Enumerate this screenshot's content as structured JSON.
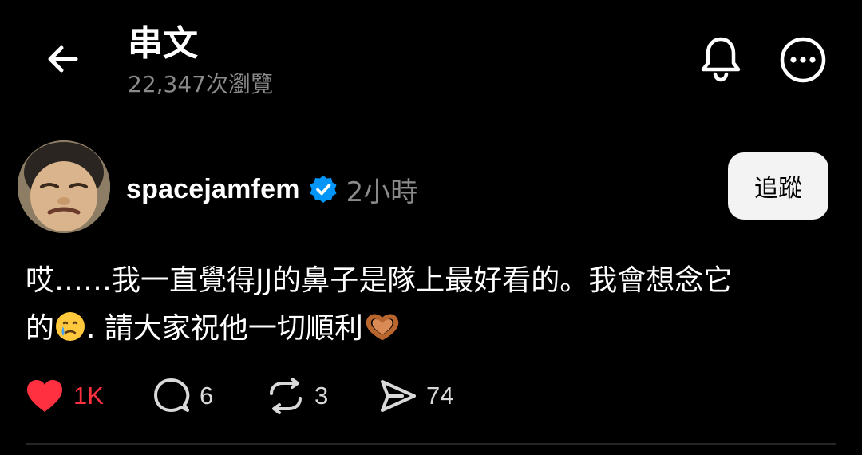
{
  "header": {
    "title": "串文",
    "views": "22,347次瀏覽",
    "back_icon": "arrow-left-icon",
    "bell_icon": "bell-icon",
    "more_icon": "more-horizontal-icon"
  },
  "post": {
    "username": "spacejamfem",
    "verified": true,
    "time": "2小時",
    "follow_label": "追蹤",
    "text_line1": "哎……我一直覺得JJ的鼻子是隊上最好看的。我會想念它",
    "text_line2_a": "的",
    "text_line2_b": ". 請大家祝他一切順利",
    "emojis": [
      "face-holding-back-tears",
      "heart-hands"
    ]
  },
  "actions": {
    "likes": "1K",
    "comments": "6",
    "reposts": "3",
    "shares": "74"
  },
  "colors": {
    "background": "#000000",
    "like_red": "#ff3040",
    "verified_blue": "#0095f6",
    "muted_text": "#8a8a8a"
  }
}
